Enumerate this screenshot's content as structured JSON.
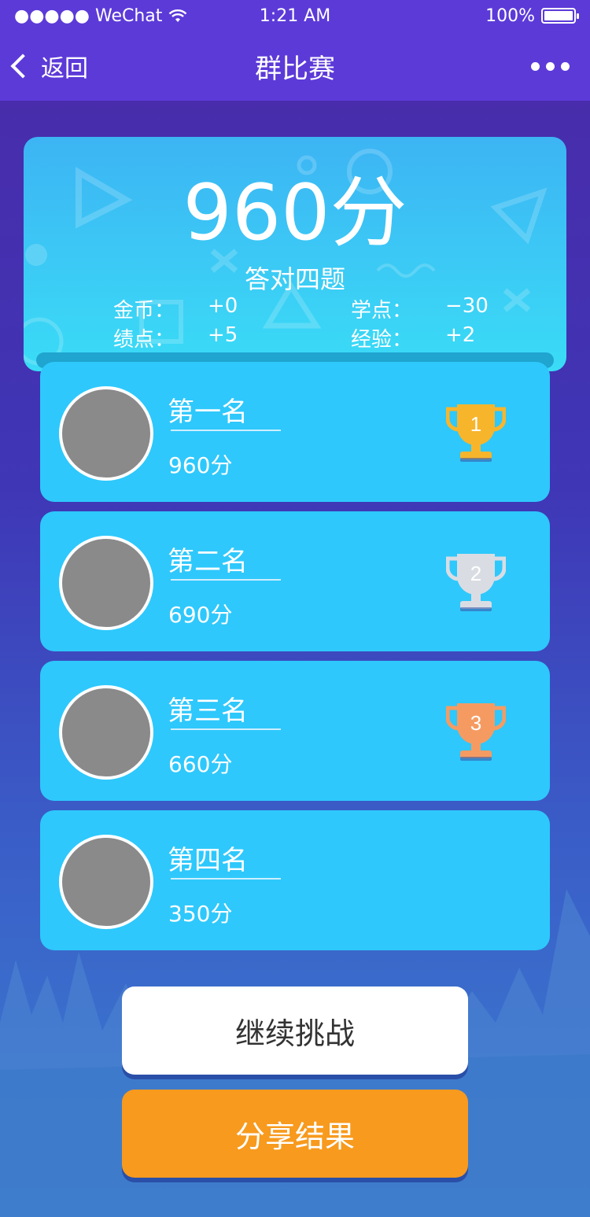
{
  "statusbar": {
    "carrier": "●●●●● WeChat",
    "time": "1:21 AM",
    "battery": "100%"
  },
  "navbar": {
    "back_label": "返回",
    "title": "群比赛"
  },
  "result": {
    "score": "960分",
    "summary": "答对四题",
    "stats": {
      "coins_label": "金币：",
      "coins_value": "+0",
      "points_label": "学点：",
      "points_value": "−30",
      "merit_label": "绩点：",
      "merit_value": "+5",
      "exp_label": "经验：",
      "exp_value": "+2"
    }
  },
  "ranking": [
    {
      "rank": "第一名",
      "score": "960分",
      "trophy": "1",
      "trophy_color": "#f7b52c"
    },
    {
      "rank": "第二名",
      "score": "690分",
      "trophy": "2",
      "trophy_color": "#d9dde3"
    },
    {
      "rank": "第三名",
      "score": "660分",
      "trophy": "3",
      "trophy_color": "#f59b62"
    },
    {
      "rank": "第四名",
      "score": "350分"
    }
  ],
  "buttons": {
    "continue": "继续挑战",
    "share": "分享结果"
  },
  "colors": {
    "header": "#5c3ad8",
    "card": "#2ec8fc",
    "share": "#f79a1e"
  }
}
